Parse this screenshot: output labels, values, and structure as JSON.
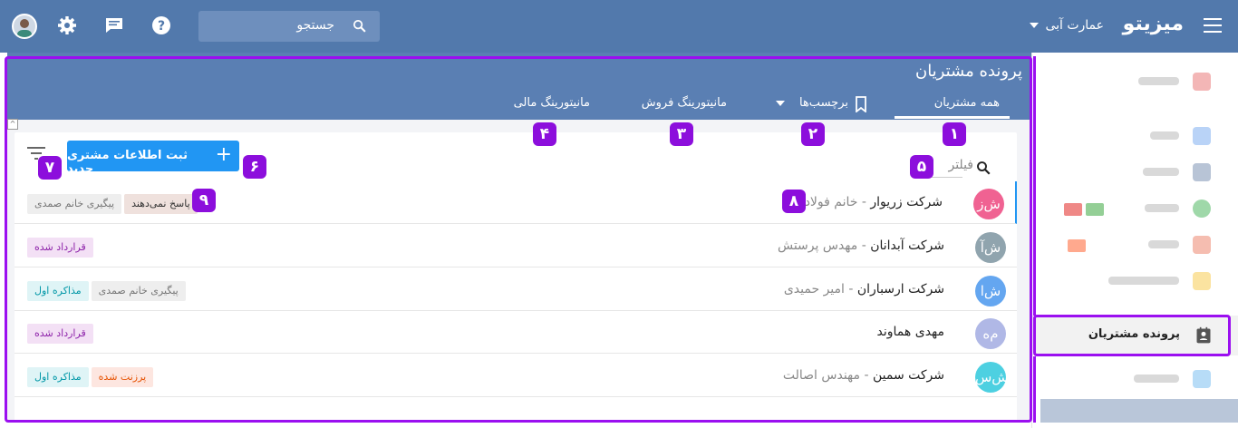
{
  "topbar": {
    "brand": "میزیتو",
    "org": "عمارت آبی",
    "search_placeholder": "جستجو",
    "icons": [
      "menu-icon",
      "search-icon",
      "help-icon",
      "chat-icon",
      "gear-icon"
    ]
  },
  "page": {
    "title": "پرونده مشتریان",
    "tabs": [
      {
        "label": "همه مشتریان",
        "active": true
      },
      {
        "label": "برچسب‌ها"
      },
      {
        "label": "مانیتورینگ فروش"
      },
      {
        "label": "مانیتورینگ مالی"
      }
    ],
    "new_button": "ثبت اطلاعات مشتری جدید",
    "filter_placeholder": "فیلتر"
  },
  "sidebar": {
    "active_label": "پرونده مشتریان"
  },
  "markers": [
    "۱",
    "۲",
    "۳",
    "۴",
    "۵",
    "۶",
    "۷",
    "۸",
    "۹"
  ],
  "customers": [
    {
      "initials": "ش‌ز",
      "name": "شرکت زریوار",
      "contact": "خانم فولادی",
      "color": "#f06292",
      "tags": [
        {
          "label": "پاسخ نمی‌دهند",
          "style": "brown"
        },
        {
          "label": "پیگیری خانم صمدی",
          "style": "gray"
        }
      ]
    },
    {
      "initials": "ش‌آ",
      "name": "شرکت آبدانان",
      "contact": "مهدس پرستش",
      "color": "#90a4ae",
      "tags": [
        {
          "label": "قرارداد شده",
          "style": "purple"
        }
      ]
    },
    {
      "initials": "ش‌ا",
      "name": "شرکت ارسباران",
      "contact": "امیر حمیدی",
      "color": "#64a6f0",
      "tags": [
        {
          "label": "پیگیری خانم صمدی",
          "style": "gray"
        },
        {
          "label": "مذاکره اول",
          "style": "teal"
        }
      ]
    },
    {
      "initials": "م‌ه",
      "name": "مهدی هماوند",
      "contact": "",
      "color": "#b0b8e6",
      "tags": [
        {
          "label": "قرارداد شده",
          "style": "purple"
        }
      ]
    },
    {
      "initials": "ش‌س",
      "name": "شرکت سمین",
      "contact": "مهندس اصالت",
      "color": "#4dd0e1",
      "tags": [
        {
          "label": "پرزنت شده",
          "style": "orange"
        },
        {
          "label": "مذاکره اول",
          "style": "teal"
        }
      ]
    }
  ]
}
